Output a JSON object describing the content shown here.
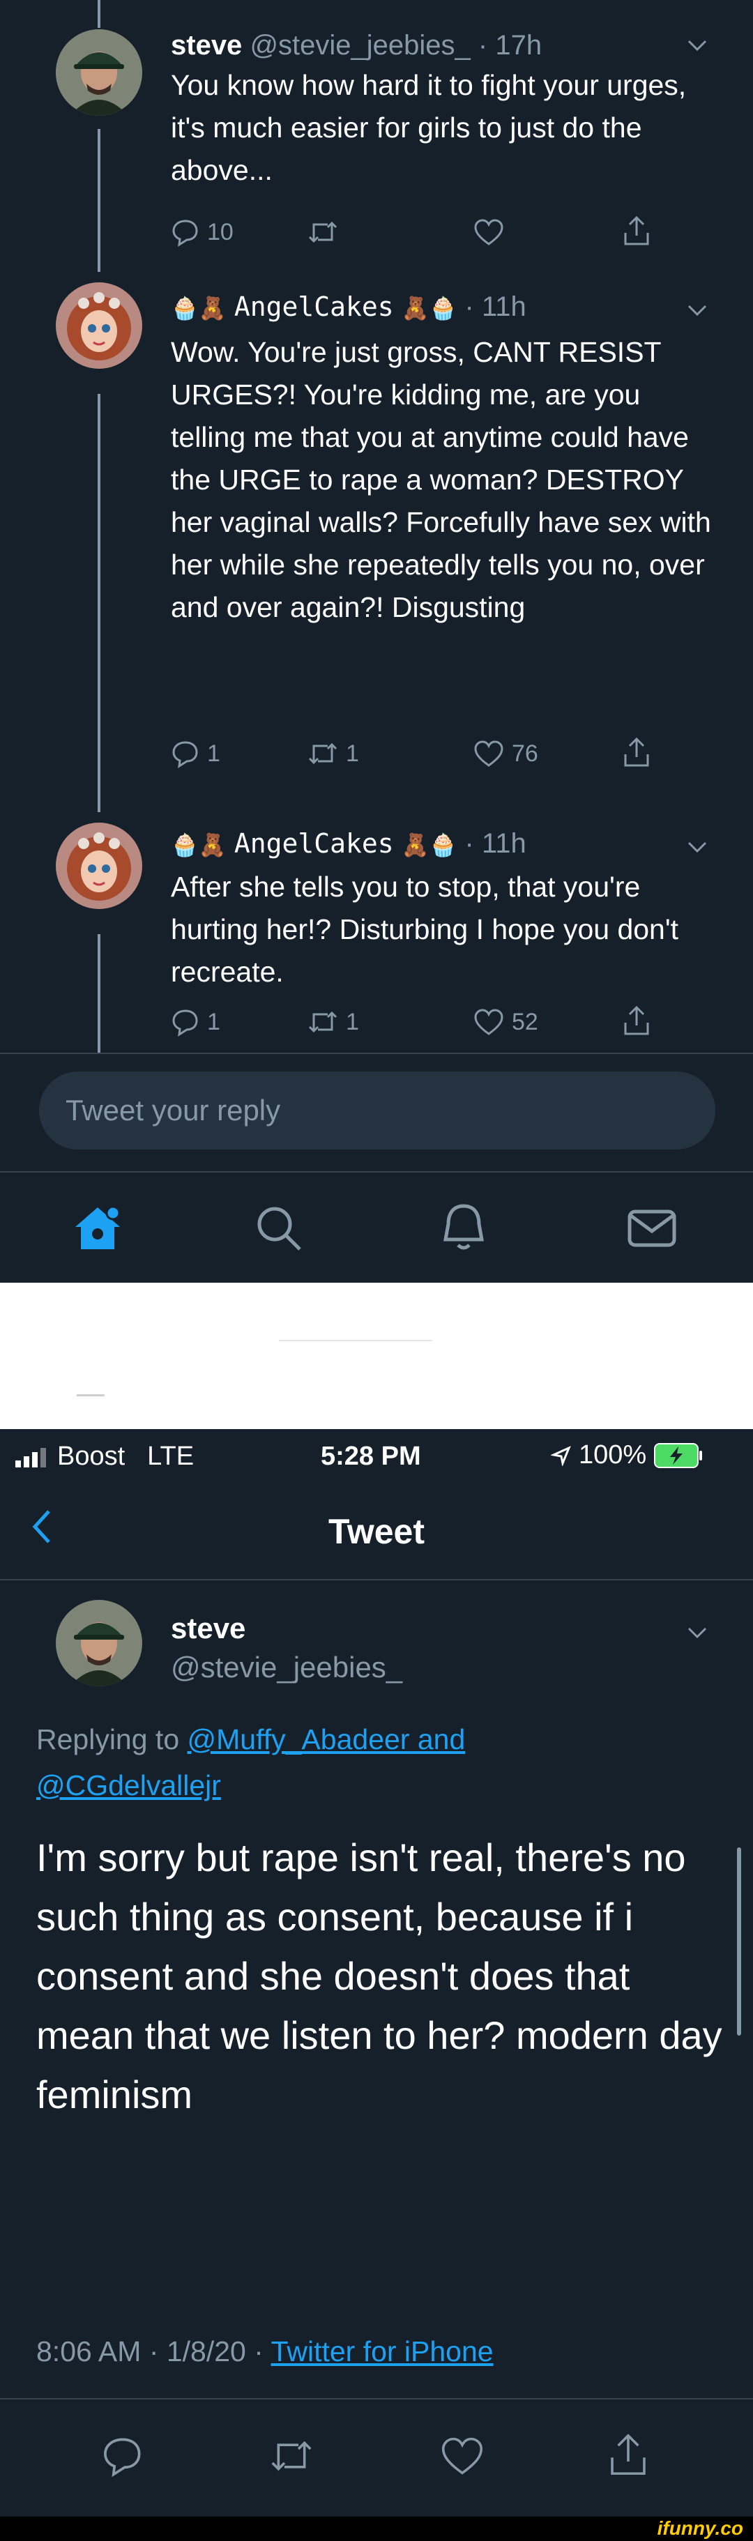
{
  "thread": {
    "tweets": [
      {
        "display_name": "steve",
        "handle": "@stevie_jeebies_",
        "time": "· 17h",
        "text": "You know how hard it to fight your urges, it's much easier for girls to just do the above...",
        "replies": "10",
        "retweets": "",
        "likes": ""
      },
      {
        "display_name": "🧁🧸AngelCakes🧸🧁",
        "display_name_text": "AngelCakes",
        "time": "· 11h",
        "text": "Wow. You're just gross, CANT RESIST URGES?! You're kidding me, are you telling me that you at anytime could have the URGE to rape a woman? DESTROY her vaginal walls? Forcefully have sex with her while she repeatedly tells you no, over and over again?! Disgusting",
        "replies": "1",
        "retweets": "1",
        "likes": "76"
      },
      {
        "display_name": "🧁🧸AngelCakes🧸🧁",
        "display_name_text": "AngelCakes",
        "time": "· 11h",
        "text": "After she tells you to stop, that you're hurting her!? Disturbing I hope you don't recreate.",
        "replies": "1",
        "retweets": "1",
        "likes": "52"
      }
    ],
    "reply_placeholder": "Tweet your reply"
  },
  "tab_bar": [
    "home-icon",
    "search-icon",
    "notifications-icon",
    "messages-icon"
  ],
  "status_bar": {
    "signal": "Boost",
    "network": "LTE",
    "time": "5:28 PM",
    "battery": "100%"
  },
  "detail": {
    "header_title": "Tweet",
    "display_name": "steve",
    "handle": "@stevie_jeebies_",
    "replying_prefix": "Replying to ",
    "replying_to_1": "@Muffy_Abadeer",
    "replying_and": " and",
    "replying_to_2": "@CGdelvallejr",
    "text": "I'm sorry but rape isn't real, there's no such thing as consent, because if i consent and she doesn't does that mean that we listen to her? modern day feminism",
    "timestamp": "8:06 AM · 1/8/20 · ",
    "source": "Twitter for iPhone"
  },
  "watermark": "ifunny.co",
  "colors": {
    "background": "#15202b",
    "muted": "#8899a6",
    "accent": "#1da1f2",
    "battery": "#4cd964"
  }
}
